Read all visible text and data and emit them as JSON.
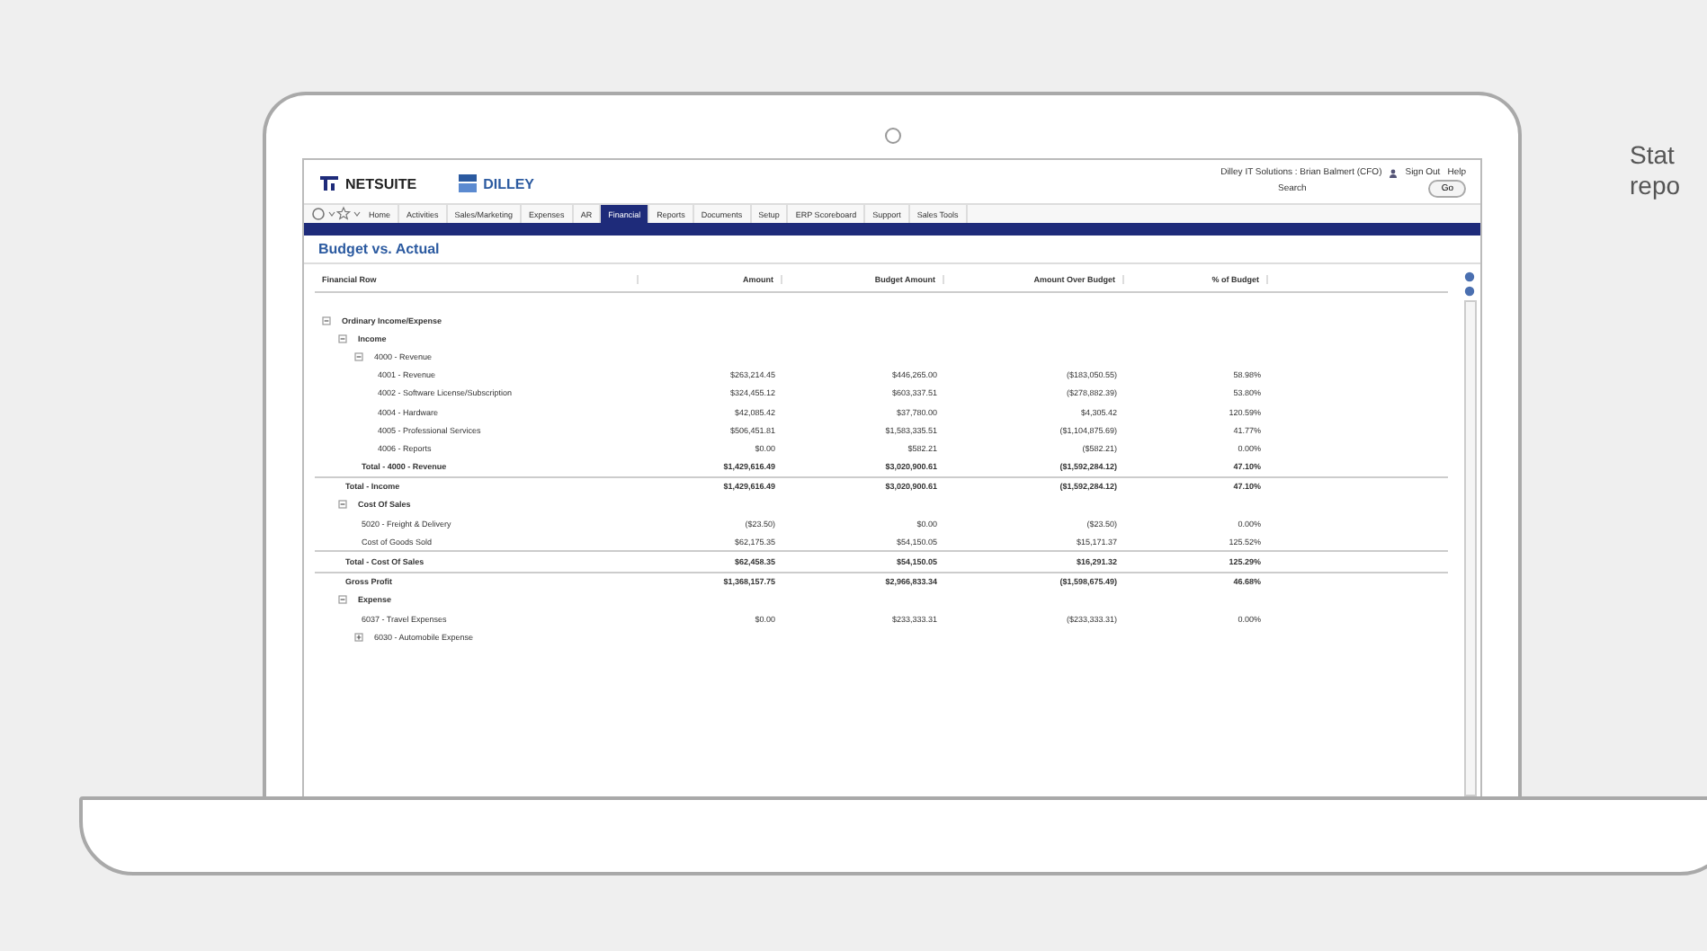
{
  "app": {
    "logo": "NETSUITE",
    "partner_logo": "DILLEY",
    "user": "Dilley IT Solutions : Brian Balmert (CFO)",
    "links": [
      "Sign Out",
      "Help"
    ],
    "search_label": "Search",
    "search_button": "Go"
  },
  "nav": [
    {
      "label": "Home",
      "selected": false
    },
    {
      "label": "Activities",
      "selected": false
    },
    {
      "label": "Sales/Marketing",
      "selected": false
    },
    {
      "label": "Expenses",
      "selected": false
    },
    {
      "label": "AR",
      "selected": false
    },
    {
      "label": "Financial",
      "selected": true
    },
    {
      "label": "Reports",
      "selected": false
    },
    {
      "label": "Documents",
      "selected": false
    },
    {
      "label": "Setup",
      "selected": false
    },
    {
      "label": "ERP Scoreboard",
      "selected": false
    },
    {
      "label": "Support",
      "selected": false
    },
    {
      "label": "Sales Tools",
      "selected": false
    }
  ],
  "report": {
    "title": "Budget vs. Actual",
    "columns": [
      "Financial Row",
      "Amount",
      "Budget Amount",
      "Amount Over Budget",
      "% of Budget"
    ],
    "rows": [
      {
        "label": "Ordinary Income/Expense",
        "kind": "group",
        "expanded": true,
        "children": [
          {
            "label": "Income",
            "kind": "group",
            "expanded": true,
            "children": [
              {
                "label": "4000 - Revenue",
                "kind": "group",
                "expanded": true,
                "children": [
                  {
                    "label": "4001 - Revenue",
                    "kind": "line",
                    "values": [
                      "$263,214.45",
                      "$446,265.00",
                      "($183,050.55)",
                      "58.98%"
                    ]
                  },
                  {
                    "label": "4002 - Software License/Subscription",
                    "kind": "line",
                    "values": [
                      "$324,455.12",
                      "$603,337.51",
                      "($278,882.39)",
                      "53.80%"
                    ]
                  },
                  {
                    "label": "4004 - Hardware",
                    "kind": "line",
                    "values": [
                      "$42,085.42",
                      "$37,780.00",
                      "$4,305.42",
                      "120.59%"
                    ]
                  },
                  {
                    "label": "4005 - Professional Services",
                    "kind": "line",
                    "values": [
                      "$506,451.81",
                      "$1,583,335.51",
                      "($1,104,875.69)",
                      "41.77%"
                    ]
                  },
                  {
                    "label": "4006 - Reports",
                    "kind": "line",
                    "values": [
                      "$0.00",
                      "$582.21",
                      "($582.21)",
                      "0.00%"
                    ]
                  }
                ]
              },
              {
                "label": "Total - 4000 - Revenue",
                "kind": "total",
                "values": [
                  "$1,429,616.49",
                  "$3,020,900.61",
                  "($1,592,284.12)",
                  "47.10%"
                ]
              }
            ]
          },
          {
            "label": "Total - Income",
            "kind": "total",
            "values": [
              "$1,429,616.49",
              "$3,020,900.61",
              "($1,592,284.12)",
              "47.10%"
            ]
          },
          {
            "label": "Cost Of Sales",
            "kind": "group",
            "expanded": true,
            "children": [
              {
                "label": "5020 - Freight & Delivery",
                "kind": "line",
                "values": [
                  "($23.50)",
                  "$0.00",
                  "($23.50)",
                  "0.00%"
                ]
              },
              {
                "label": "Cost of Goods Sold",
                "kind": "line",
                "values": [
                  "$62,175.35",
                  "$54,150.05",
                  "$15,171.37",
                  "125.52%"
                ]
              }
            ]
          },
          {
            "label": "Total - Cost Of Sales",
            "kind": "total",
            "values": [
              "$62,458.35",
              "$54,150.05",
              "$16,291.32",
              "125.29%"
            ]
          },
          {
            "label": "Gross Profit",
            "kind": "total",
            "values": [
              "$1,368,157.75",
              "$2,966,833.34",
              "($1,598,675.49)",
              "46.68%"
            ]
          },
          {
            "label": "Expense",
            "kind": "group",
            "expanded": true,
            "children": [
              {
                "label": "6037 - Travel Expenses",
                "kind": "line",
                "values": [
                  "$0.00",
                  "$233,333.31",
                  "($233,333.31)",
                  "0.00%"
                ]
              },
              {
                "label": "6030 - Automobile Expense",
                "kind": "group",
                "expanded": false
              }
            ]
          }
        ]
      }
    ]
  },
  "caption": [
    "Stat",
    "repo"
  ]
}
